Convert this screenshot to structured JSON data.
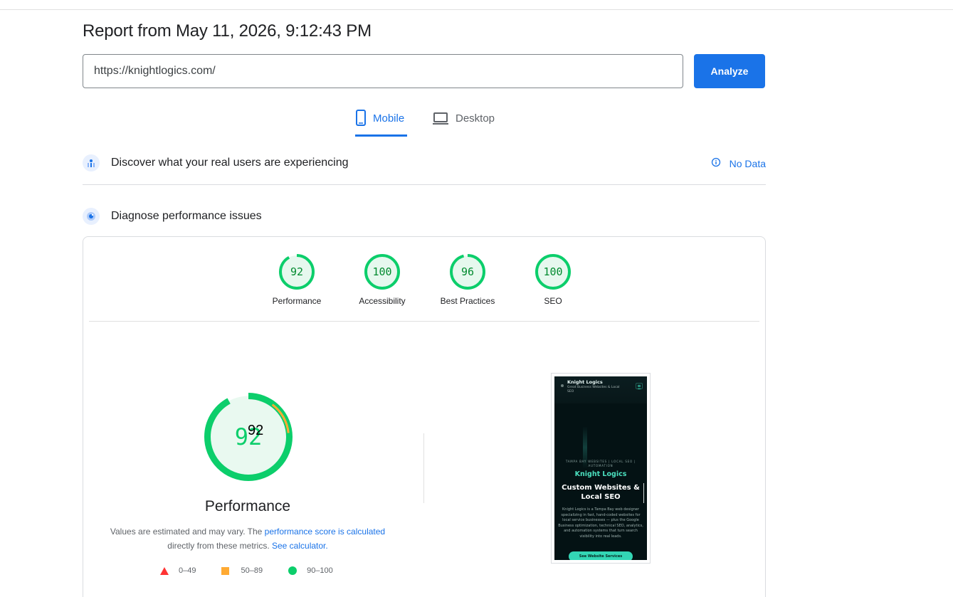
{
  "report": {
    "title": "Report from May 11, 2026, 9:12:43 PM",
    "url_value": "https://knightlogics.com/",
    "analyze_label": "Analyze"
  },
  "tabs": [
    {
      "label": "Mobile",
      "icon": "smartphone-icon",
      "active": true
    },
    {
      "label": "Desktop",
      "icon": "laptop-icon",
      "active": false
    }
  ],
  "crux": {
    "title": "Discover what your real users are experiencing",
    "status": "No Data",
    "icon": "users-icon",
    "status_icon": "info-icon"
  },
  "diagnose": {
    "title": "Diagnose performance issues",
    "icon": "lighthouse-icon"
  },
  "categories": [
    {
      "label": "Performance",
      "score": "92",
      "value": 92
    },
    {
      "label": "Accessibility",
      "score": "100",
      "value": 100
    },
    {
      "label": "Best Practices",
      "score": "96",
      "value": 96
    },
    {
      "label": "SEO",
      "score": "100",
      "value": 100
    }
  ],
  "performance": {
    "score": "92",
    "overlay_score": "92",
    "value": 92,
    "label": "Performance",
    "note_prefix": "Values are estimated and may vary. The ",
    "note_link": "performance score is calculated",
    "note_mid": "directly from these metrics.",
    "note_link2": "See calculator."
  },
  "legend": [
    {
      "range": "0–49",
      "shape": "triangle",
      "color": "#ff3333"
    },
    {
      "range": "50–89",
      "shape": "square",
      "color": "#ffaa33"
    },
    {
      "range": "90–100",
      "shape": "circle",
      "color": "#0cce6b"
    }
  ],
  "screenshot": {
    "brand": "Knight Logics",
    "tagline": "Great Business Websites & Local SEO",
    "kicker": "TAMPA BAY WEBSITES | LOCAL SEO | AUTOMATION",
    "site_name": "Knight Logics",
    "headline": "Custom Websites & Local SEO",
    "description": "Knight Logics is a Tampa Bay web designer specializing in fast, hand-coded websites for local service businesses — plus the Google Business optimization, technical SEO, analytics, and automation systems that turn search visibility into real leads.",
    "cta": "See Website Services"
  },
  "colors": {
    "accent": "#1a73e8",
    "pass": "#0cce6b",
    "average": "#ffaa33",
    "fail": "#ff3333"
  }
}
